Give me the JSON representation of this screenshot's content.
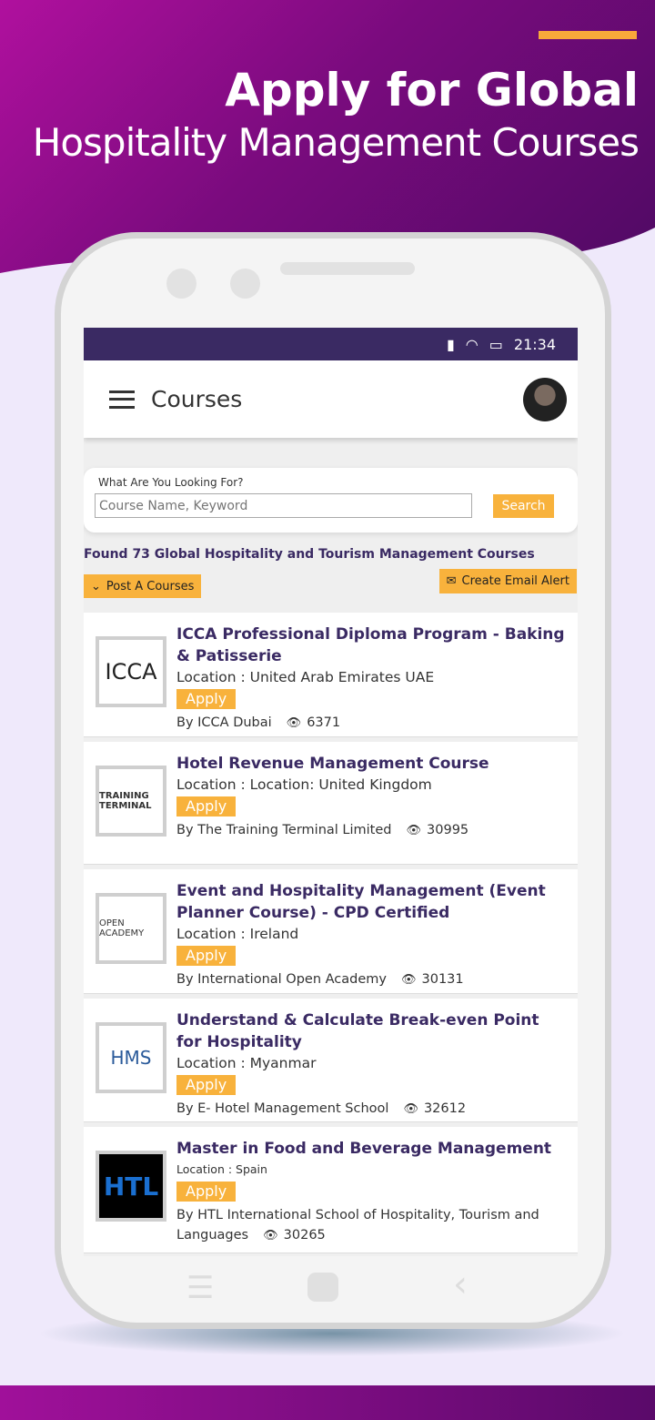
{
  "promo": {
    "headline": "Apply for Global",
    "subheadline": "Hospitality Management Courses"
  },
  "status_bar": {
    "time": "21:34",
    "icons": [
      "signal-icon",
      "wifi-icon",
      "battery-icon"
    ]
  },
  "app_bar": {
    "title": "Courses",
    "menu_icon": "hamburger-menu-icon"
  },
  "search": {
    "label": "What Are You Looking For?",
    "placeholder": "Course Name, Keyword",
    "button": "Search"
  },
  "results": {
    "found_text": "Found 73 Global Hospitality and Tourism Management Courses",
    "post_button": "Post A Courses",
    "alert_button": "Create Email Alert"
  },
  "colors": {
    "primary": "#3a2a63",
    "accent": "#f8b23c"
  },
  "courses": [
    {
      "title": "ICCA Professional Diploma Program - Baking & Patisserie",
      "location": "Location : United Arab Emirates UAE",
      "apply": "Apply",
      "provider": "By ICCA Dubai",
      "views": "6371",
      "logo": "ICCA"
    },
    {
      "title": "Hotel Revenue Management Course",
      "location": "Location : Location: United Kingdom",
      "apply": "Apply",
      "provider": "By The Training Terminal Limited",
      "views": "30995",
      "logo": "TRAINING TERMINAL"
    },
    {
      "title": "Event and Hospitality Management (Event Planner Course) - CPD Certified",
      "location": "Location : Ireland",
      "apply": "Apply",
      "provider": "By International Open Academy",
      "views": "30131",
      "logo": "OPEN ACADEMY"
    },
    {
      "title": "Understand & Calculate Break-even Point for Hospitality",
      "location": "Location : Myanmar",
      "apply": "Apply",
      "provider": "By E- Hotel Management School",
      "views": "32612",
      "logo": "HMS"
    },
    {
      "title": "Master in Food and Beverage Management",
      "location": "Location : Spain",
      "apply": "Apply",
      "provider": "By HTL International School of Hospitality, Tourism and Languages",
      "views": "30265",
      "logo": "HTL"
    }
  ]
}
